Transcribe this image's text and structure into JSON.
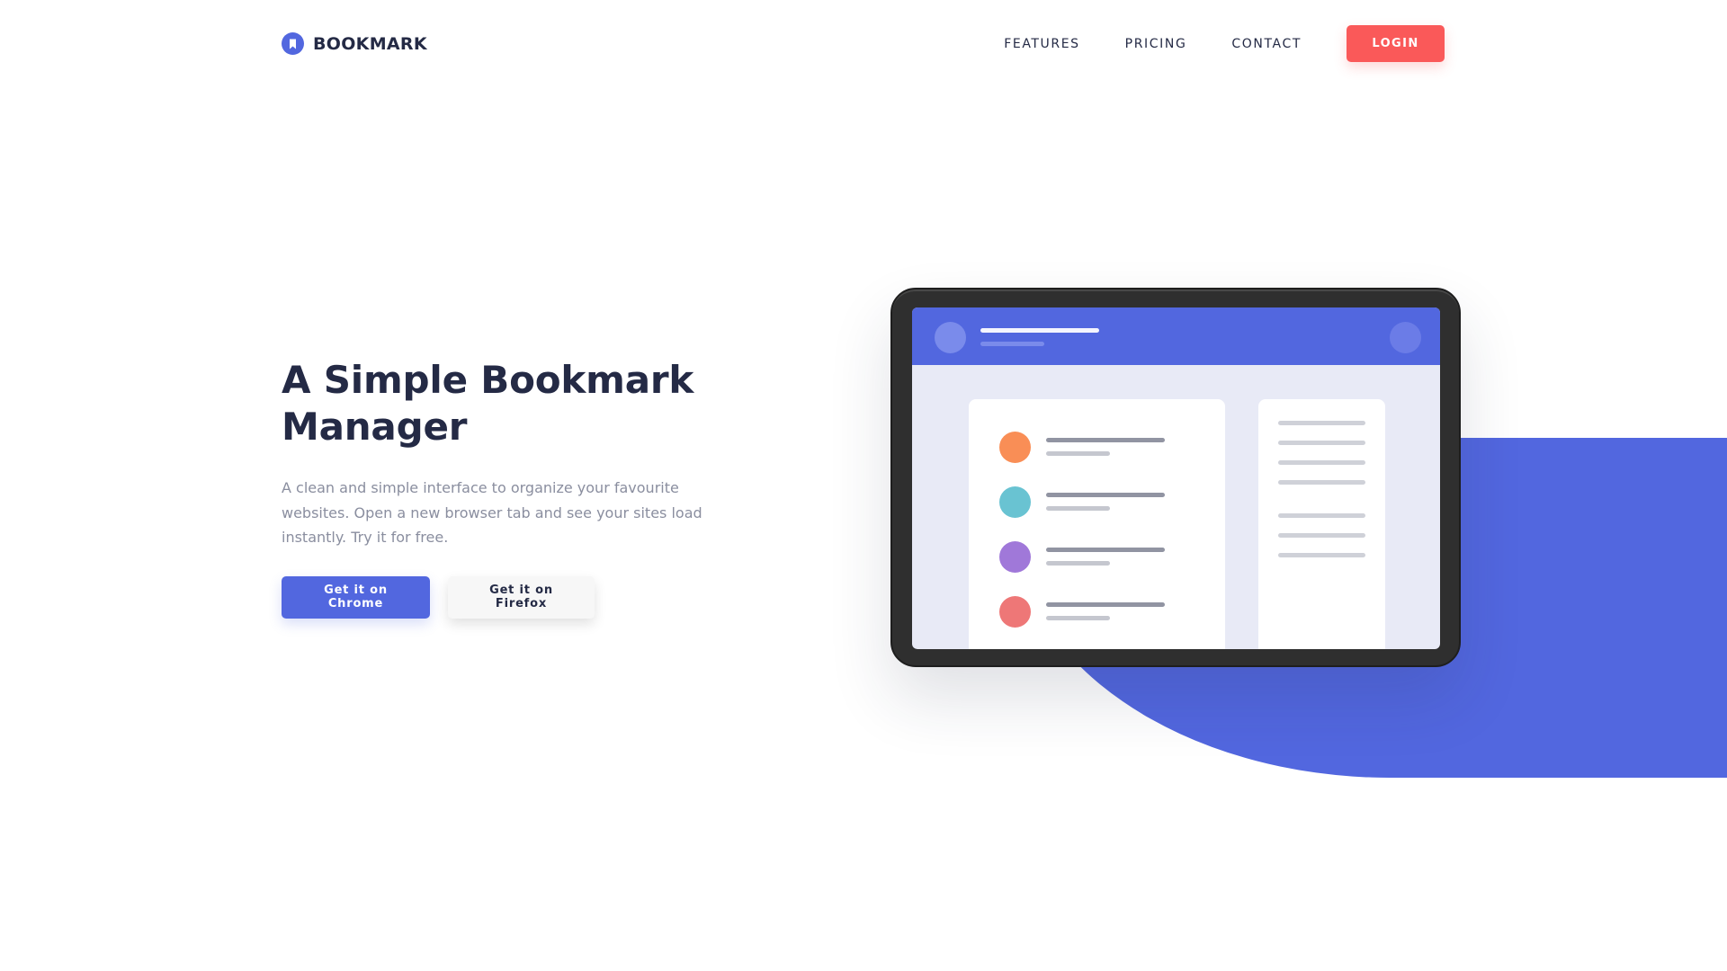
{
  "brand": {
    "name": "BOOKMARK",
    "icon": "bookmark-icon",
    "color": "#5267DF"
  },
  "nav": {
    "items": [
      {
        "label": "FEATURES"
      },
      {
        "label": "PRICING"
      },
      {
        "label": "CONTACT"
      }
    ],
    "login_label": "LOGIN",
    "login_color": "#FA5959"
  },
  "hero": {
    "title": "A Simple Bookmark Manager",
    "description": "A clean and simple interface to organize your favourite websites. Open a new browser tab and see your sites load instantly. Try it for free.",
    "chrome_button": "Get it on Chrome",
    "firefox_button": "Get it on Firefox"
  },
  "illustration": {
    "name": "tablet-bookmark-preview",
    "accent_color": "#5267DF",
    "dot_colors": [
      "#F98E56",
      "#69C3D2",
      "#A078D9",
      "#EE7777"
    ]
  }
}
